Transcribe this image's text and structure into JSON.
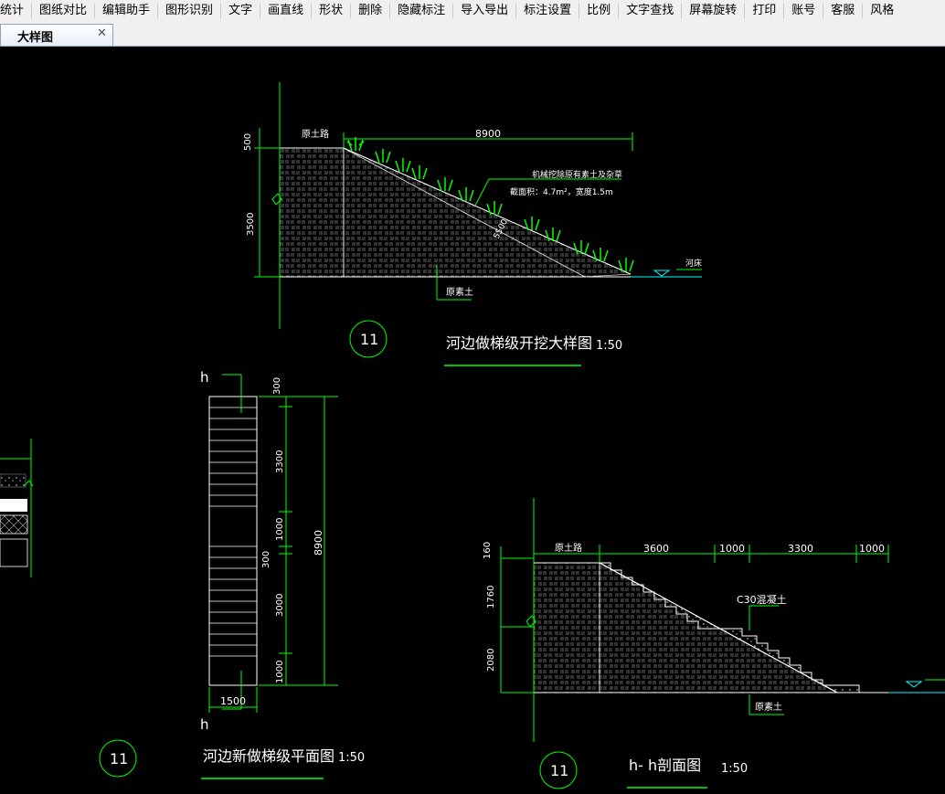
{
  "menu": {
    "items": [
      "统计",
      "图纸对比",
      "编辑助手",
      "图形识别",
      "文字",
      "画直线",
      "形状",
      "删除",
      "隐藏标注",
      "导入导出",
      "标注设置",
      "比例",
      "文字查找",
      "屏幕旋转",
      "打印",
      "账号",
      "客服",
      "风格"
    ]
  },
  "tabs": {
    "active_label": "大样图",
    "close_glyph": "✕"
  },
  "drawing": {
    "top": {
      "label_road": "原土路",
      "label_soil": "原素土",
      "label_river": "河床",
      "dim_500": "500",
      "dim_3500": "3500",
      "dim_8900": "8900",
      "dim_slope": "5500",
      "note_line1": "机械挖除原有素土及杂草",
      "note_line2": "截面积：4.7m²，宽度1.5m",
      "detail_no": "11",
      "title": "河边做梯级开挖大样图",
      "scale": "1:50"
    },
    "plan": {
      "section_mark": "h",
      "dims": [
        "300",
        "3300",
        "1000",
        "300",
        "3000",
        "1000"
      ],
      "dim_total": "8900",
      "dim_width": "1500",
      "detail_no": "11",
      "title": "河边新做梯级平面图",
      "scale": "1:50"
    },
    "section": {
      "label_road": "原土路",
      "label_soil": "原素土",
      "label_concrete": "C30混凝土",
      "dims_top": [
        "3600",
        "1000",
        "3300",
        "1000"
      ],
      "dims_left": [
        "160",
        "1760",
        "2080"
      ],
      "detail_no": "11",
      "title": "h- h剖面图",
      "scale": "1:50"
    }
  },
  "colors": {
    "background": "#000000",
    "green": "#00ff00",
    "white": "#ffffff",
    "cyan": "#00ffff"
  }
}
